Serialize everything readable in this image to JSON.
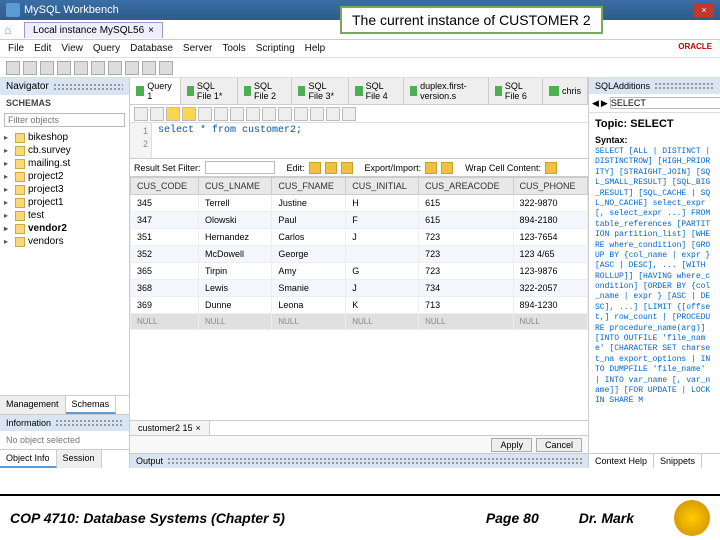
{
  "titlebar": {
    "title": "MySQL Workbench"
  },
  "callout": "The current instance of CUSTOMER 2",
  "tab": {
    "label": "Local instance MySQL56",
    "close": "×"
  },
  "menu": [
    "File",
    "Edit",
    "View",
    "Query",
    "Database",
    "Server",
    "Tools",
    "Scripting",
    "Help"
  ],
  "oracle": "ORACLE",
  "nav": {
    "header": "Navigator",
    "schemas": "SCHEMAS",
    "filter_placeholder": "Filter objects",
    "items": [
      "bikeshop",
      "cb.survey",
      "mailing.st",
      "project2",
      "project3",
      "project1",
      "test",
      "vendor2",
      "vendors"
    ],
    "tabs": [
      "Management",
      "Schemas"
    ],
    "info": "Information",
    "info_body": "No object selected",
    "bottom_tabs": [
      "Object Info",
      "Session"
    ]
  },
  "query": {
    "tabs": [
      "Query 1",
      "SQL File 1*",
      "SQL File 2",
      "SQL File 3*",
      "SQL File 4",
      "duplex.first-version.s",
      "SQL File 6",
      "chris"
    ],
    "line1": "1",
    "line2": "2",
    "sql": "select * from customer2;"
  },
  "results": {
    "filter_label": "Result Set Filter:",
    "edit": "Edit:",
    "export": "Export/Import:",
    "wrap": "Wrap Cell Content:",
    "headers": [
      "CUS_CODE",
      "CUS_LNAME",
      "CUS_FNAME",
      "CUS_INITIAL",
      "CUS_AREACODE",
      "CUS_PHONE"
    ],
    "rows": [
      [
        "345",
        "Terrell",
        "Justine",
        "H",
        "615",
        "322-9870"
      ],
      [
        "347",
        "Olowski",
        "Paul",
        "F",
        "615",
        "894-2180"
      ],
      [
        "351",
        "Hernandez",
        "Carlos",
        "J",
        "723",
        "123-7654"
      ],
      [
        "352",
        "McDowell",
        "George",
        "",
        "723",
        "123 4/65"
      ],
      [
        "365",
        "Tirpin",
        "Amy",
        "G",
        "723",
        "123-9876"
      ],
      [
        "368",
        "Lewis",
        "Smanie",
        "J",
        "734",
        "322-2057"
      ],
      [
        "369",
        "Dunne",
        "Leona",
        "K",
        "713",
        "894-1230"
      ]
    ],
    "null_row": [
      "NULL",
      "NULL",
      "NULL",
      "NULL",
      "NULL",
      "NULL"
    ],
    "tab": "customer2 15"
  },
  "actions": {
    "apply": "Apply",
    "cancel": "Cancel"
  },
  "output": "Output",
  "right": {
    "header": "SQLAdditions",
    "select": "SELECT",
    "topic": "Topic: SELECT",
    "syntax_label": "Syntax:",
    "syntax": "SELECT [ALL | DISTINCT | DISTINCTROW] [HIGH_PRIORITY] [STRAIGHT_JOIN] [SQL_SMALL_RESULT] [SQL_BIG_RESULT] [SQL_CACHE | SQL_NO_CACHE] select_expr [, select_expr ...] FROM table_references [PARTITION partition_list] [WHERE where_condition] [GROUP BY {col_name | expr } [ASC | DESC], ... [WITH ROLLUP]] [HAVING where_condition] [ORDER BY {col_name | expr } [ASC | DESC], ...] [LIMIT {[offset,] row_count | [PROCEDURE procedure_name(arg)] [INTO OUTFILE 'file_name' [CHARACTER SET charset_na export_options | INTO DUMPFILE 'file_name' | INTO var_name [, var_name]] [FOR UPDATE | LOCK IN SHARE M",
    "tabs": [
      "Context Help",
      "Snippets"
    ]
  },
  "footer": {
    "left": "COP 4710: Database Systems  (Chapter 5)",
    "center": "Page 80",
    "right": "Dr. Mark"
  }
}
